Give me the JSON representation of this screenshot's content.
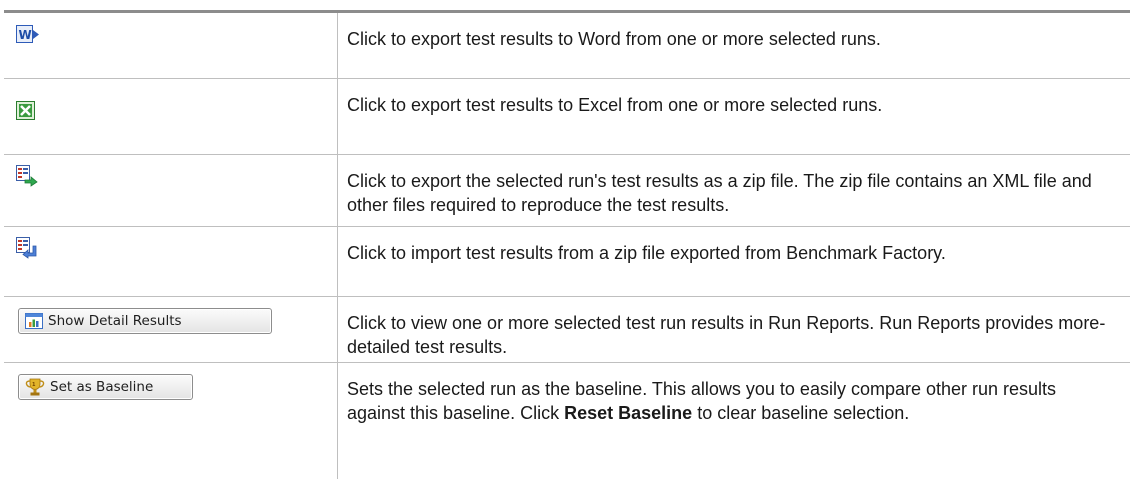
{
  "rows": [
    {
      "icon": "export-word-icon",
      "description": "Click to export test results to Word from one or more selected runs."
    },
    {
      "icon": "export-excel-icon",
      "description": "Click to export test results to Excel from one or more selected runs."
    },
    {
      "icon": "export-zip-icon",
      "description": "Click to export the selected run's test results as a zip file. The zip file contains an XML file and other files required to reproduce the test results."
    },
    {
      "icon": "import-zip-icon",
      "description": "Click to import test results from a zip file exported from Benchmark Factory."
    },
    {
      "icon": "chart-icon",
      "button_label": "Show Detail Results",
      "description": "Click to view one or more selected test run results in Run Reports. Run Reports provides more-detailed test results."
    },
    {
      "icon": "trophy-icon",
      "button_label": "Set as Baseline",
      "description_before": "Sets the selected run as the baseline. This allows you to easily compare other run results against this baseline. Click ",
      "description_bold": "Reset Baseline",
      "description_after": " to clear baseline selection."
    }
  ]
}
